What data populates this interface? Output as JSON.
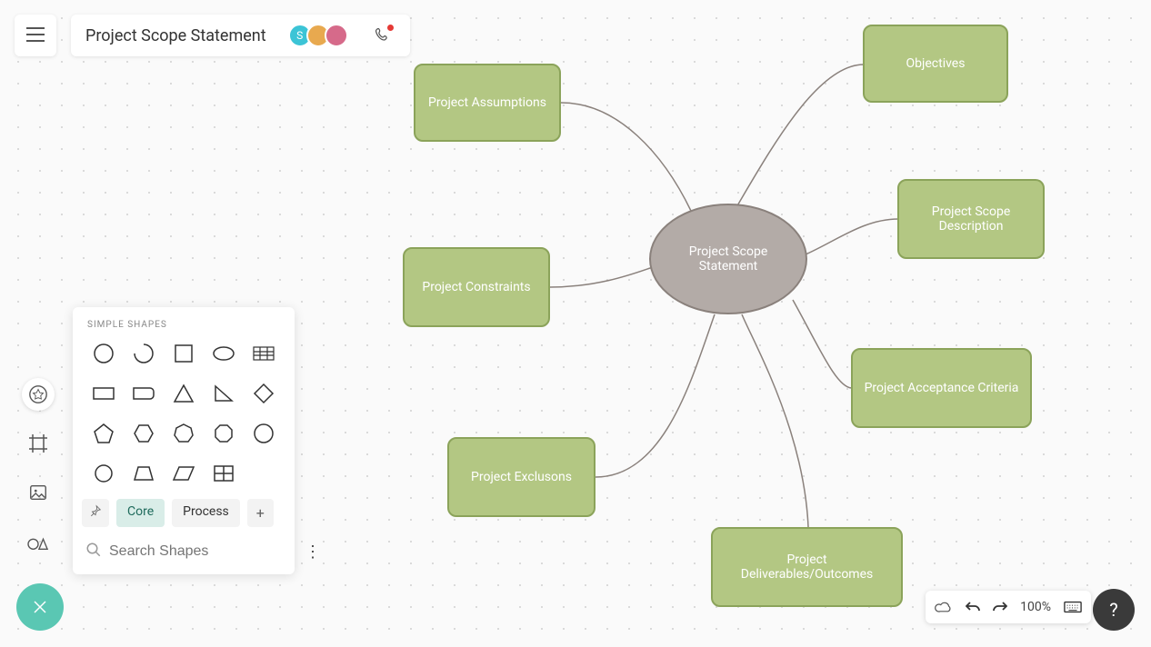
{
  "header": {
    "title": "Project Scope Statement",
    "avatars": [
      "S",
      "",
      ""
    ],
    "call_notification": true
  },
  "shapes_panel": {
    "title": "SIMPLE SHAPES",
    "tabs": {
      "pin": "📌",
      "core": "Core",
      "process": "Process",
      "plus": "+"
    },
    "search_placeholder": "Search Shapes"
  },
  "diagram": {
    "center": "Project Scope Statement",
    "nodes": {
      "assumptions": "Project Assumptions",
      "constraints": "Project Constraints",
      "exclusions": "Project Exclusons",
      "deliverables": "Project Deliverables/Outcomes",
      "acceptance": "Project Acceptance Criteria",
      "scope_desc": "Project Scope Description",
      "objectives": "Objectives"
    }
  },
  "bottom": {
    "zoom": "100%"
  },
  "help": "?"
}
